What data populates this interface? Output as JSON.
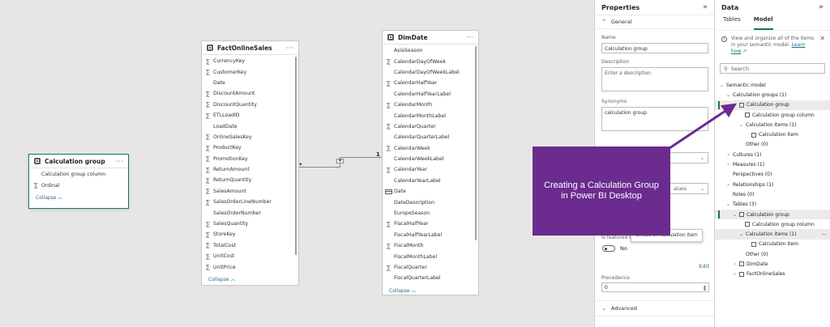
{
  "canvas": {
    "calc_group_card": {
      "title": "Calculation group",
      "fields": [
        {
          "name": "Calculation group column",
          "icon": "none"
        },
        {
          "name": "Ordinal",
          "icon": "sigma"
        }
      ],
      "collapse": "Collapse"
    },
    "fact_card": {
      "title": "FactOnlineSales",
      "fields": [
        {
          "name": "CurrencyKey",
          "icon": "sigma"
        },
        {
          "name": "CustomerKey",
          "icon": "sigma"
        },
        {
          "name": "Date",
          "icon": "none"
        },
        {
          "name": "DiscountAmount",
          "icon": "sigma"
        },
        {
          "name": "DiscountQuantity",
          "icon": "sigma"
        },
        {
          "name": "ETLLoadID",
          "icon": "sigma"
        },
        {
          "name": "LoadDate",
          "icon": "none"
        },
        {
          "name": "OnlineSalesKey",
          "icon": "sigma"
        },
        {
          "name": "ProductKey",
          "icon": "sigma"
        },
        {
          "name": "PromotionKey",
          "icon": "sigma"
        },
        {
          "name": "ReturnAmount",
          "icon": "sigma"
        },
        {
          "name": "ReturnQuantity",
          "icon": "sigma"
        },
        {
          "name": "SalesAmount",
          "icon": "sigma"
        },
        {
          "name": "SalesOrderLineNumber",
          "icon": "sigma"
        },
        {
          "name": "SalesOrderNumber",
          "icon": "none"
        },
        {
          "name": "SalesQuantity",
          "icon": "sigma"
        },
        {
          "name": "StoreKey",
          "icon": "sigma"
        },
        {
          "name": "TotalCost",
          "icon": "sigma"
        },
        {
          "name": "UnitCost",
          "icon": "sigma"
        },
        {
          "name": "UnitPrice",
          "icon": "sigma"
        }
      ],
      "collapse": "Collapse"
    },
    "date_card": {
      "title": "DimDate",
      "fields": [
        {
          "name": "AsiaSeason",
          "icon": "none"
        },
        {
          "name": "CalendarDayOfWeek",
          "icon": "sigma"
        },
        {
          "name": "CalendarDayOfWeekLabel",
          "icon": "none"
        },
        {
          "name": "CalendarHalfYear",
          "icon": "sigma"
        },
        {
          "name": "CalendarHalfYearLabel",
          "icon": "none"
        },
        {
          "name": "CalendarMonth",
          "icon": "sigma"
        },
        {
          "name": "CalendarMonthLabel",
          "icon": "none"
        },
        {
          "name": "CalendarQuarter",
          "icon": "sigma"
        },
        {
          "name": "CalendarQuarterLabel",
          "icon": "none"
        },
        {
          "name": "CalendarWeek",
          "icon": "sigma"
        },
        {
          "name": "CalendarWeekLabel",
          "icon": "none"
        },
        {
          "name": "CalendarYear",
          "icon": "sigma"
        },
        {
          "name": "CalendarYearLabel",
          "icon": "none"
        },
        {
          "name": "Date",
          "icon": "calendar"
        },
        {
          "name": "DateDescription",
          "icon": "none"
        },
        {
          "name": "EuropeSeason",
          "icon": "none"
        },
        {
          "name": "FiscalHalfYear",
          "icon": "sigma"
        },
        {
          "name": "FiscalHalfYearLabel",
          "icon": "none"
        },
        {
          "name": "FiscalMonth",
          "icon": "sigma"
        },
        {
          "name": "FiscalMonthLabel",
          "icon": "none"
        },
        {
          "name": "FiscalQuarter",
          "icon": "sigma"
        },
        {
          "name": "FiscalQuarterLabel",
          "icon": "none"
        }
      ],
      "collapse": "Collapse"
    },
    "relationship": {
      "many": "*",
      "one": "1"
    }
  },
  "properties": {
    "title": "Properties",
    "general": "General",
    "name_label": "Name",
    "name_value": "Calculation group",
    "description_label": "Description",
    "description_placeholder": "Enter a description",
    "synonyms_label": "Synonyms",
    "synonyms_value": "calculation group",
    "values_fragment": "alues",
    "featured_fragment": "Is featured ta",
    "tooltip": "Create an calculation item",
    "toggle_label": "No",
    "edit": "Edit",
    "precedence_label": "Precedence",
    "precedence_value": "0",
    "advanced": "Advanced"
  },
  "data_pane": {
    "title": "Data",
    "tabs": [
      "Tables",
      "Model"
    ],
    "info_text": "View and organize all of the items in your semantic model.",
    "learn_link": "Learn how",
    "search_placeholder": "Search",
    "tree": {
      "semantic_model": "Semantic model",
      "calc_groups": "Calculation groups (1)",
      "calc_group": "Calculation group",
      "calc_group_column": "Calculation group column",
      "calc_items": "Calculation items (1)",
      "calc_item": "Calculation item",
      "other": "Other (0)",
      "cultures": "Cultures (1)",
      "measures": "Measures (1)",
      "perspectives": "Perspectives (0)",
      "relationships": "Relationships (1)",
      "roles": "Roles (0)",
      "tables": "Tables (3)",
      "t_calc_group": "Calculation group",
      "t_calc_group_column": "Calculation group column",
      "t_calc_items": "Calculation items (1)",
      "t_calc_item": "Calculation item",
      "t_other": "Other (0)",
      "dimdate": "DimDate",
      "factonline": "FactOnlineSales"
    }
  },
  "callout": {
    "line1": "Creating a Calculation Group",
    "line2": "in Power BI Desktop"
  },
  "colors": {
    "accent": "#117865",
    "callout_bg": "#6b2b8f",
    "link": "#1f6f8b"
  }
}
